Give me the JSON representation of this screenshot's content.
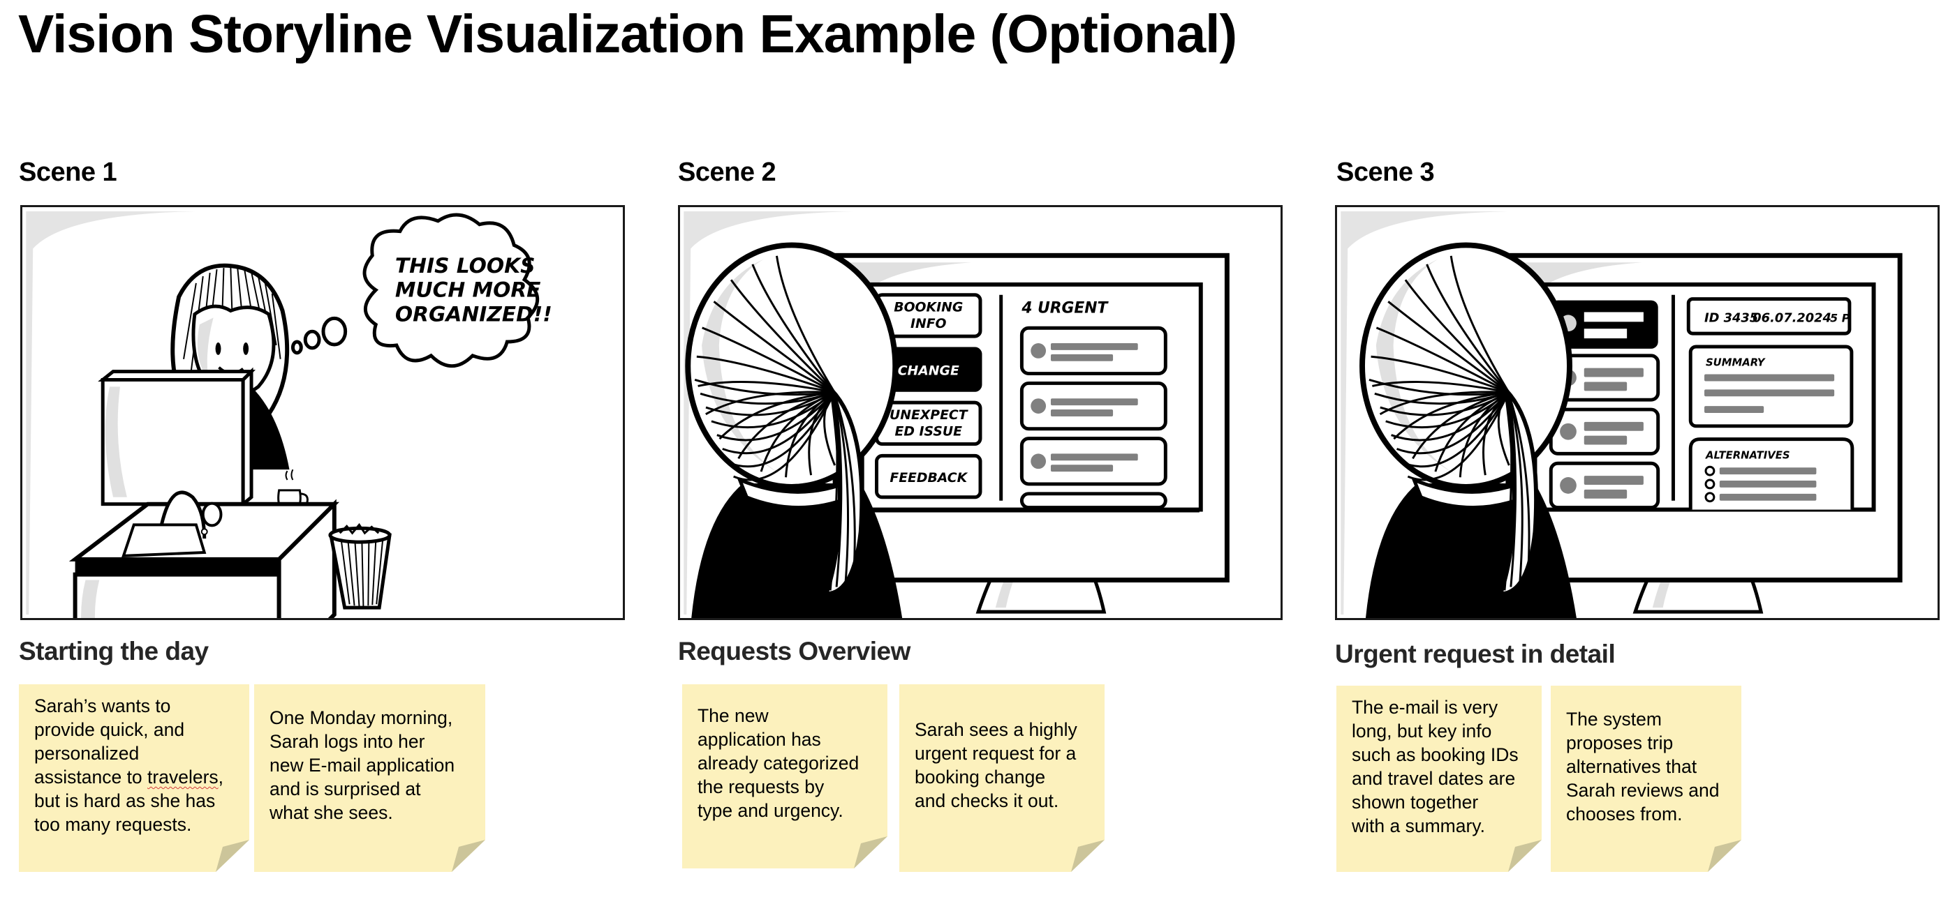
{
  "page": {
    "title": "Vision Storyline Visualization Example (Optional)"
  },
  "scenes": [
    {
      "label": "Scene 1",
      "title": "Starting the day",
      "illustration": {
        "thought_bubble": [
          "THIS LOOKS",
          "MUCH MORE",
          "ORGANIZED!!"
        ]
      },
      "notes": [
        {
          "lines": [
            "Sarah’s wants to",
            "provide quick, and",
            "personalized",
            "assistance to travelers,",
            "but is hard as she has",
            "too many requests."
          ],
          "spellcheck_word": "travelers"
        },
        {
          "lines": [
            "One Monday morning,",
            "Sarah logs into her",
            "new E-mail application",
            "and is surprised at",
            "what she sees."
          ]
        }
      ]
    },
    {
      "label": "Scene 2",
      "title": "Requests Overview",
      "illustration": {
        "categories": [
          "BOOKING INFO",
          "CHANGE",
          "UNEXPECTED ISSUE",
          "FEEDBACK"
        ],
        "category_lines": [
          [
            "BOOKING",
            "INFO"
          ],
          [
            "CHANGE"
          ],
          [
            "UNEXPECT",
            "ED ISSUE"
          ],
          [
            "FEEDBACK"
          ]
        ],
        "selected_category": "CHANGE",
        "list_header": "4 URGENT",
        "list_count": 4
      },
      "notes": [
        {
          "lines": [
            "The new",
            "application has",
            "already categorized",
            "the requests by",
            "type and urgency."
          ]
        },
        {
          "lines": [
            "Sarah sees a highly",
            "urgent request for a",
            "booking change",
            "and checks it out."
          ]
        }
      ]
    },
    {
      "label": "Scene 3",
      "title": "Urgent request in detail",
      "illustration": {
        "header_id": "ID 3435",
        "header_date": "06.07.2024",
        "header_people": "5 P",
        "summary_label": "SUMMARY",
        "alternatives_label": "ALTERNATIVES",
        "alternatives_count": 3
      },
      "notes": [
        {
          "lines": [
            "The e-mail is very",
            "long, but key info",
            "such as booking IDs",
            "and travel dates are",
            "shown together",
            "with a summary."
          ]
        },
        {
          "lines": [
            "The system",
            "proposes trip",
            "alternatives that",
            "Sarah reviews and",
            "chooses from."
          ]
        }
      ]
    }
  ],
  "colors": {
    "sticky": "#fcf1bd",
    "sticky_fold": "#ccc59a",
    "placeholder_bar": "#808080",
    "ink": "#000000",
    "shade": "#e0e0e0"
  }
}
